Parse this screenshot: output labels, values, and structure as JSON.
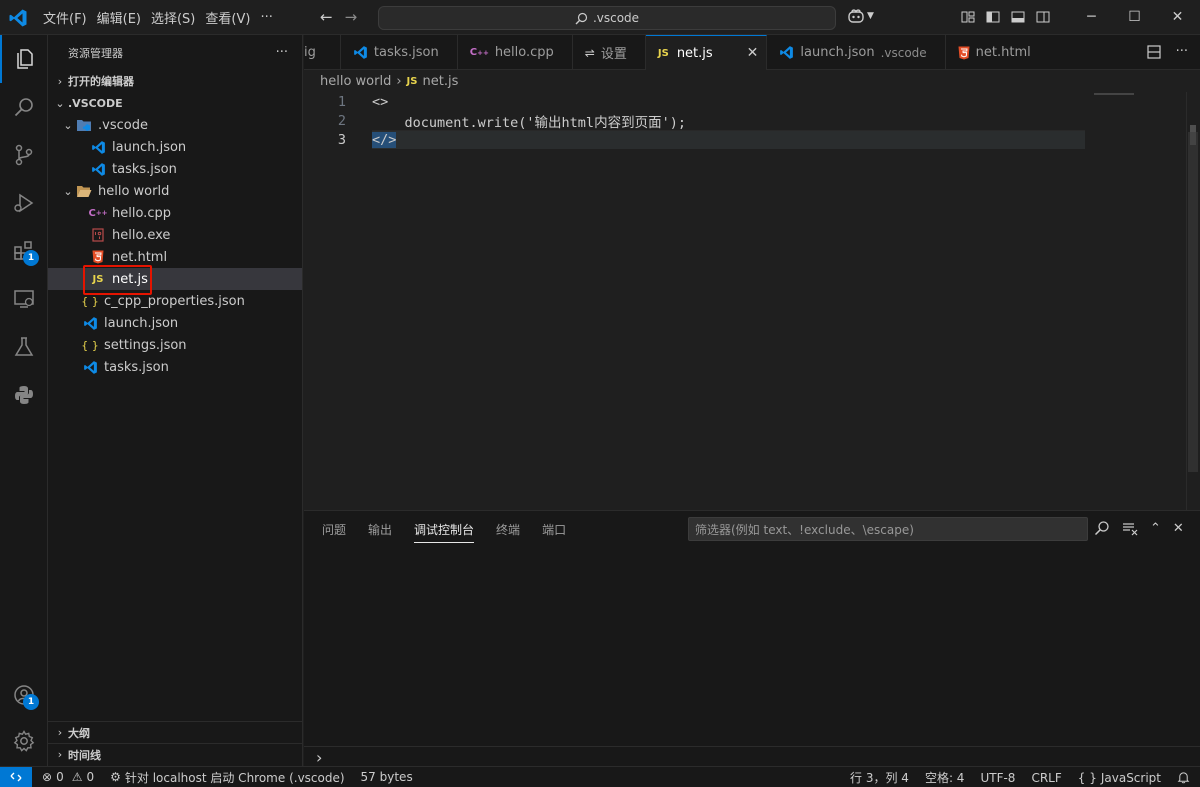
{
  "titlebar": {
    "menu": [
      "文件(F)",
      "编辑(E)",
      "选择(S)",
      "查看(V)",
      "···"
    ],
    "search_text": ".vscode"
  },
  "activity": {
    "extensions_badge": "1",
    "accounts_badge": "1"
  },
  "sidebar": {
    "title": "资源管理器",
    "more": "···",
    "open_editors": "打开的编辑器",
    "workspace": ".VSCODE",
    "tree": [
      {
        "label": ".vscode",
        "kind": "folder",
        "depth": 1
      },
      {
        "label": "launch.json",
        "kind": "vscode",
        "depth": 2
      },
      {
        "label": "tasks.json",
        "kind": "vscode",
        "depth": 2
      },
      {
        "label": "hello world",
        "kind": "folder",
        "depth": 1
      },
      {
        "label": "hello.cpp",
        "kind": "cpp",
        "depth": 2
      },
      {
        "label": "hello.exe",
        "kind": "exe",
        "depth": 2
      },
      {
        "label": "net.html",
        "kind": "html",
        "depth": 2
      },
      {
        "label": "net.js",
        "kind": "js",
        "depth": 2
      },
      {
        "label": "c_cpp_properties.json",
        "kind": "json",
        "depth": 1
      },
      {
        "label": "launch.json",
        "kind": "vscode",
        "depth": 1
      },
      {
        "label": "settings.json",
        "kind": "json",
        "depth": 1
      },
      {
        "label": "tasks.json",
        "kind": "vscode",
        "depth": 1
      }
    ],
    "outline": "大纲",
    "timeline": "时间线"
  },
  "tabs": [
    {
      "label": "ig",
      "kind": "partial"
    },
    {
      "label": "tasks.json",
      "kind": "vscode"
    },
    {
      "label": "hello.cpp",
      "kind": "cpp"
    },
    {
      "label": "设置",
      "kind": "settings"
    },
    {
      "label": "net.js",
      "kind": "js",
      "active": true
    },
    {
      "label": "launch.json",
      "kind": "vscode",
      "desc": ".vscode"
    },
    {
      "label": "net.html",
      "kind": "html"
    }
  ],
  "breadcrumb": {
    "folder": "hello world",
    "file": "net.js",
    "file_icon": "JS"
  },
  "editor": {
    "lines": [
      {
        "num": "1",
        "text": "<>"
      },
      {
        "num": "2",
        "text": "    document.write('输出html内容到页面');"
      },
      {
        "num": "3",
        "text": "</>"
      }
    ]
  },
  "panel": {
    "tabs": [
      "问题",
      "输出",
      "调试控制台",
      "终端",
      "端口"
    ],
    "active_tab": "调试控制台",
    "filter_placeholder": "筛选器(例如 text、!exclude、\\escape)",
    "prompt": "›"
  },
  "statusbar": {
    "errors": "0",
    "warnings": "0",
    "launch": "针对 localhost 启动 Chrome (.vscode)",
    "size": "57 bytes",
    "position": "行 3，列 4",
    "spaces": "空格: 4",
    "encoding": "UTF-8",
    "eol": "CRLF",
    "language": "JavaScript",
    "language_prefix": "{ }"
  },
  "colors": {
    "accent": "#0078d4",
    "highlight_box": "#e51400",
    "js_icon": "#e8d44d",
    "html_icon": "#e44d26",
    "vscode_icon": "#0e8ae5",
    "cpp_icon": "#c36ec6"
  }
}
